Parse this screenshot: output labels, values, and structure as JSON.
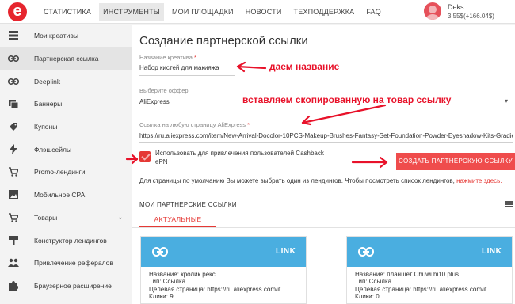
{
  "nav": {
    "items": [
      "СТАТИСТИКА",
      "ИНСТРУМЕНТЫ",
      "МОИ ПЛОЩАДКИ",
      "НОВОСТИ",
      "ТЕХПОДДЕРЖКА",
      "FAQ"
    ],
    "active_index": 1
  },
  "user": {
    "name": "Deks",
    "balance": "3.55$(+166.04$)"
  },
  "sidebar": {
    "items": [
      {
        "label": "Мои креативы",
        "icon": "creatives-icon"
      },
      {
        "label": "Партнерская ссылка",
        "icon": "link-icon"
      },
      {
        "label": "Deeplink",
        "icon": "link-icon"
      },
      {
        "label": "Баннеры",
        "icon": "banner-icon"
      },
      {
        "label": "Купоны",
        "icon": "coupon-icon"
      },
      {
        "label": "Флэшсейлы",
        "icon": "flash-icon"
      },
      {
        "label": "Promo-лендинги",
        "icon": "cart-icon"
      },
      {
        "label": "Мобильное CPA",
        "icon": "image-icon"
      },
      {
        "label": "Товары",
        "icon": "cart-icon"
      },
      {
        "label": "Конструктор лендингов",
        "icon": "brush-icon"
      },
      {
        "label": "Привлечение рефералов",
        "icon": "group-icon"
      },
      {
        "label": "Браузерное расширение",
        "icon": "puzzle-icon"
      }
    ],
    "active_index": 1
  },
  "form": {
    "title": "Создание партнерской ссылки",
    "name_label": "Название креатива",
    "name_value": "Набор кистей для макияжа",
    "offer_label": "Выберите оффер",
    "offer_value": "AliExpress",
    "url_label": "Ссылка на любую страницу AliExpress",
    "url_value": "https://ru.aliexpress.com/item/New-Arrival-Docolor-10PCS-Makeup-Brushes-Fantasy-Set-Foundation-Powder-Eyeshadow-Kits-Gradient",
    "cashback_label": "Использовать для привлечения пользователей Cashback ePN",
    "create_button": "СОЗДАТЬ ПАРТНЕРСКУЮ ССЫЛКУ",
    "hint_text": "Для страницы по умолчанию Вы можете выбрать один из лендингов. Чтобы посмотреть список лендингов,",
    "hint_link": "нажмите здесь."
  },
  "links": {
    "section_title": "МОИ ПАРТНЕРСКИЕ ССЫЛКИ",
    "tab_active": "АКТУАЛЬНЫЕ",
    "cards": [
      {
        "badge": "LINK",
        "name": "Название: кролик рекс",
        "type": "Тип: Ссылка",
        "target": "Целевая страница: https://ru.aliexpress.com/it...",
        "clicks": "Клики: 9"
      },
      {
        "badge": "LINK",
        "name": "Название: планшет Chuwi hi10 plus",
        "type": "Тип: Ссылка",
        "target": "Целевая страница: https://ru.aliexpress.com/it...",
        "clicks": "Клики: 0"
      }
    ]
  },
  "annotations": {
    "name_hint": "даем название",
    "url_hint": "вставляем скопированную на товар ссылку",
    "color": "#e8122a"
  },
  "colors": {
    "accent": "#e53935",
    "card_header": "#4aaee0",
    "button": "#ef4c4c"
  }
}
